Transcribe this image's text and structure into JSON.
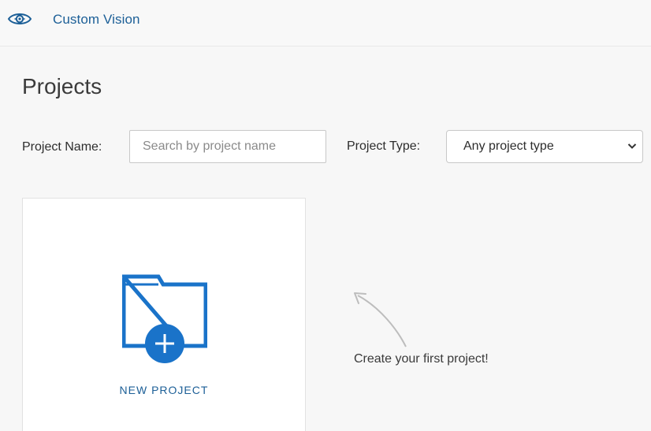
{
  "header": {
    "app_title": "Custom Vision",
    "logo_icon": "eye-icon"
  },
  "page": {
    "title": "Projects"
  },
  "filters": {
    "name_label": "Project Name:",
    "name_placeholder": "Search by project name",
    "name_value": "",
    "type_label": "Project Type:",
    "type_selected": "Any project type"
  },
  "new_project_card": {
    "label": "NEW PROJECT",
    "icon": "folder-add-icon"
  },
  "hint": {
    "text": "Create your first project!",
    "icon": "curved-arrow-icon"
  },
  "colors": {
    "brand": "#1c5f97",
    "accent": "#1a73c9",
    "background": "#f7f7f7"
  }
}
